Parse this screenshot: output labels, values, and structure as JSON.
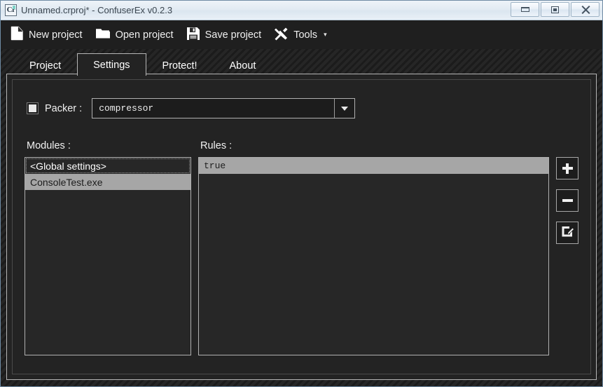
{
  "window": {
    "title": "Unnamed.crproj* - ConfuserEx v0.2.3",
    "icon_name": "confuserex-app-icon",
    "icon_text": "Cr",
    "controls": {
      "minimize_label": "Minimize",
      "maximize_label": "Maximize",
      "close_label": "Close"
    }
  },
  "toolbar": {
    "items": [
      {
        "label": "New project",
        "icon": "new-document-icon"
      },
      {
        "label": "Open project",
        "icon": "open-folder-icon"
      },
      {
        "label": "Save project",
        "icon": "floppy-disk-save-icon"
      },
      {
        "label": "Tools",
        "icon": "tools-wrench-hammer-icon",
        "caret": "▾"
      }
    ]
  },
  "tabs": [
    {
      "label": "Project",
      "active": false
    },
    {
      "label": "Settings",
      "active": true
    },
    {
      "label": "Protect!",
      "active": false
    },
    {
      "label": "About",
      "active": false
    }
  ],
  "settings": {
    "packer": {
      "checkbox_name": "packer-enabled-checkbox",
      "checked": true,
      "label": "Packer :",
      "value": "compressor",
      "dropdown_icon": "chevron-down-icon"
    },
    "modules": {
      "label": "Modules :",
      "items": [
        {
          "text": "<Global settings>",
          "state": "focused"
        },
        {
          "text": "ConsoleTest.exe",
          "state": "selected"
        }
      ]
    },
    "rules": {
      "label": "Rules :",
      "items": [
        {
          "text": "true",
          "state": "selected"
        }
      ]
    },
    "rule_buttons": [
      {
        "name": "add-rule-button",
        "icon": "plus-icon",
        "label": "+"
      },
      {
        "name": "remove-rule-button",
        "icon": "minus-icon",
        "label": "−"
      },
      {
        "name": "edit-rule-button",
        "icon": "edit-pencil-icon",
        "label": "Edit"
      }
    ]
  },
  "colors": {
    "window_bg": "#222222",
    "titlebar_bg": "#e6eef6",
    "panel_bg": "#232323",
    "selection_bg": "#a6a6a6",
    "text_light": "#f0f0f0",
    "border_light": "#b0b0b0"
  }
}
